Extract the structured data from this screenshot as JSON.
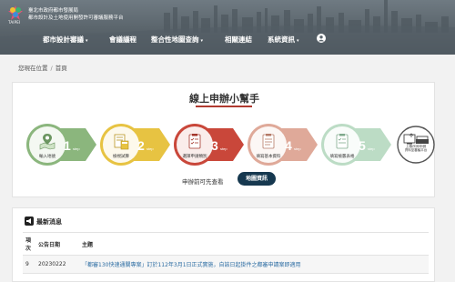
{
  "header": {
    "logo_text": "TAIPEI",
    "org_line1": "臺北市政府都市發展局",
    "org_line2": "都市設計及土地使用開發許可審議服務平台"
  },
  "nav": {
    "items": [
      {
        "label": "都市設計審議",
        "has_caret": true
      },
      {
        "label": "會議議程",
        "has_caret": false
      },
      {
        "label": "整合性地圖查詢",
        "has_caret": true
      },
      {
        "label": "相關連結",
        "has_caret": false
      },
      {
        "label": "系統資訊",
        "has_caret": true
      }
    ],
    "caret": "▾",
    "user_icon": "user-circle-icon"
  },
  "breadcrumb": {
    "current_label": "您現在位置",
    "separator": "/",
    "page": "首頁"
  },
  "helper": {
    "title": "線上申辦小幫手",
    "steps": [
      {
        "num": "1",
        "suffix": "step",
        "label": "輸入地號",
        "icon": "map-pin-icon",
        "color": "#8bb67d"
      },
      {
        "num": "2",
        "suffix": "step",
        "label": "檢視試算",
        "icon": "calculator-document-icon",
        "color": "#e7c342"
      },
      {
        "num": "3",
        "suffix": "step",
        "label": "選擇申請類別",
        "icon": "checklist-icon",
        "color": "#c9473a"
      },
      {
        "num": "4",
        "suffix": "step",
        "label": "填寫基本資料",
        "icon": "form-icon",
        "color": "#dfa999"
      },
      {
        "num": "5",
        "suffix": "step",
        "label": "填寫檢覈表格",
        "icon": "checklist-form-icon",
        "color": "#bcdcc5"
      }
    ],
    "final_step_label": "上傳/列印申請\n資料至審議平台",
    "final_step_icon": "upload-print-icon",
    "hint": "申辦前可先查看",
    "map_button": "地圖資訊"
  },
  "news": {
    "icon": "megaphone-icon",
    "title": "最新消息",
    "columns": [
      "項次",
      "公告日期",
      "主題"
    ],
    "rows": [
      {
        "no": "9",
        "date": "20230222",
        "topic": "「都審130快速通關專案」訂於112年3月1日正式實施，自該日起掛件之都審申請案即適用"
      }
    ]
  }
}
